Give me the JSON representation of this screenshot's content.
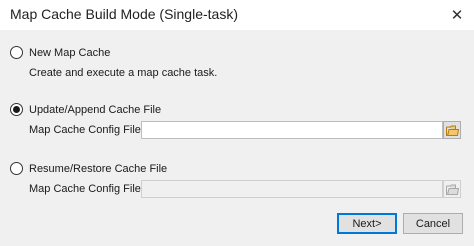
{
  "window": {
    "title": "Map Cache Build Mode (Single-task)",
    "close_icon": "close-icon"
  },
  "options": {
    "new_cache": {
      "label": "New Map Cache",
      "description": "Create and execute a map cache task.",
      "selected": false
    },
    "update_append": {
      "label": "Update/Append Cache File",
      "field_label": "Map Cache Config File:",
      "value": "",
      "selected": true
    },
    "resume_restore": {
      "label": "Resume/Restore Cache File",
      "field_label": "Map Cache Config File:",
      "value": "",
      "selected": false
    }
  },
  "buttons": {
    "next": "Next>",
    "cancel": "Cancel"
  },
  "colors": {
    "folder_active": "#e8a33c",
    "folder_disabled": "#c2c2c2",
    "focus_border": "#0078d7"
  }
}
